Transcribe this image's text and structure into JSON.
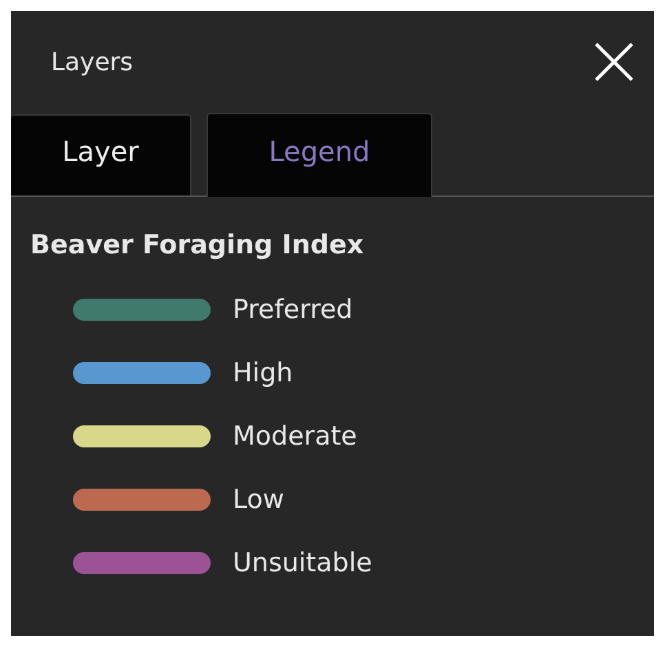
{
  "panel": {
    "title": "Layers"
  },
  "tabs": [
    {
      "label": "Layer",
      "selected": false
    },
    {
      "label": "Legend",
      "selected": true
    }
  ],
  "legend": {
    "title": "Beaver Foraging Index",
    "items": [
      {
        "label": "Preferred",
        "color": "#3f7a6c"
      },
      {
        "label": "High",
        "color": "#5897cf"
      },
      {
        "label": "Moderate",
        "color": "#d8d78a"
      },
      {
        "label": "Low",
        "color": "#bb6a50"
      },
      {
        "label": "Unsuitable",
        "color": "#9c5396"
      }
    ]
  }
}
